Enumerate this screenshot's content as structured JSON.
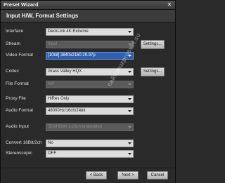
{
  "window": {
    "title": "Preset Wizard",
    "close_glyph": "✕"
  },
  "header": {
    "title": "Input H/W, Format Settings"
  },
  "rows": [
    {
      "label": "Interface",
      "value": "DeckLink 4K Extreme",
      "label_state": "normal",
      "field_state": "normal",
      "button": ""
    },
    {
      "label": "Stream",
      "value": "Input",
      "label_state": "normal",
      "field_state": "disabled",
      "button": "Settings..."
    },
    {
      "label": "Video Format",
      "value": "[10bit] 3840x2160 29.97p",
      "label_state": "normal",
      "field_state": "selected",
      "button": ""
    },
    {
      "label": "Codec",
      "value": "Grass Valley HQX",
      "label_state": "normal",
      "field_state": "normal",
      "button": "Settings..."
    },
    {
      "label": "File Format",
      "value": "AVI",
      "label_state": "normal",
      "field_state": "disabled",
      "button": ""
    },
    {
      "label": "Proxy File",
      "value": "HiRes Only",
      "label_state": "normal",
      "field_state": "normal",
      "button": ""
    },
    {
      "label": "Audio Format",
      "value": "48000Hz/16ch/24bit",
      "label_state": "normal",
      "field_state": "normal",
      "button": ""
    },
    {
      "label": "Audio Input",
      "value": "SDI/HDMI 1-16ch embedded",
      "label_state": "normal",
      "field_state": "disabled",
      "button": ""
    },
    {
      "label": "Convert 16Bit/2ch",
      "value": "No",
      "label_state": "normal",
      "field_state": "normal",
      "button": ""
    },
    {
      "label": "Stereoscopic",
      "value": "OFF",
      "label_state": "normal",
      "field_state": "normal",
      "button": ""
    }
  ],
  "footer": {
    "back": "< Back",
    "next": "Next >",
    "cancel": "Cancel"
  },
  "watermark": "сайт muzprosvet.su",
  "colors": {
    "selected": "#2f5fb0",
    "background": "#2a2a2a"
  }
}
